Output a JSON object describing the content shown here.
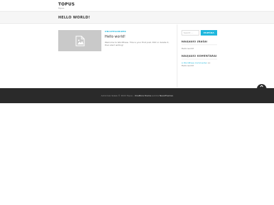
{
  "header": {
    "site_title": "TOPUS",
    "site_description": "Topus"
  },
  "page": {
    "heading": "HELLO WORLD!"
  },
  "post": {
    "category": "UNCATEGORIZED",
    "title": "Hello world!",
    "excerpt": "Welcome to WordPress. This is your first post. Edit or delete it, then start writing!",
    "thumbnail_icon": "image-placeholder-icon"
  },
  "sidebar": {
    "search_placeholder": "Search …",
    "search_button": "PAIEŠKA",
    "recent_posts_title": "NAUJAUSI ĮRAŠAI",
    "recent_posts": [
      "Hello world!"
    ],
    "recent_comments_title": "NAUJAUSI KOMENTARAI",
    "comment_author": "A WordPress Commenter",
    "comment_on": "on",
    "comment_post": "Hello world!"
  },
  "footer": {
    "text_prefix": "Autorinės teisės © 2022 Topus -",
    "theme_link": "OneMore theme",
    "text_suffix": "sukūrė",
    "author_link": "NaveThemes"
  },
  "colors": {
    "accent": "#1fb7dd",
    "footer_bg": "#2a2a2a"
  }
}
